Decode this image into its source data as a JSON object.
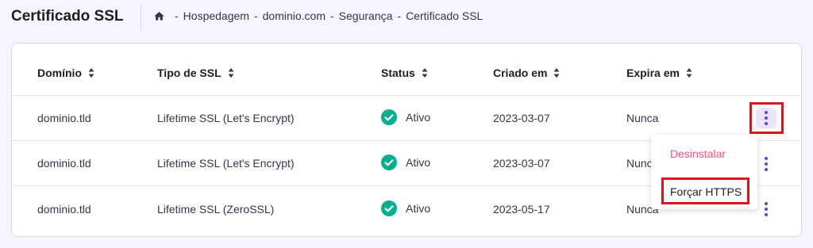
{
  "header": {
    "title": "Certificado SSL",
    "breadcrumb": [
      "Hospedagem",
      "dominio.com",
      "Segurança",
      "Certificado SSL"
    ],
    "separator": "-"
  },
  "table": {
    "columns": [
      "Domínio",
      "Tipo de SSL",
      "Status",
      "Criado em",
      "Expira em"
    ],
    "rows": [
      {
        "domain": "dominio.tld",
        "type": "Lifetime SSL (Let's Encrypt)",
        "status": "Ativo",
        "created": "2023-03-07",
        "expires": "Nunca"
      },
      {
        "domain": "dominio.tld",
        "type": "Lifetime SSL (Let's Encrypt)",
        "status": "Ativo",
        "created": "2023-03-07",
        "expires": "Nunc"
      },
      {
        "domain": "dominio.tld",
        "type": "Lifetime SSL (ZeroSSL)",
        "status": "Ativo",
        "created": "2023-05-17",
        "expires": "Nunca"
      }
    ]
  },
  "dropdown": {
    "items": [
      "Desinstalar",
      "Forçar HTTPS"
    ]
  },
  "colors": {
    "accent": "#673de6",
    "success": "#00b090",
    "danger": "#fc5185",
    "highlight": "#e0131b"
  },
  "icons": {
    "home": "home-icon",
    "sort": "sort-icon",
    "status": "check-circle-icon",
    "menu": "more-vertical-icon"
  }
}
